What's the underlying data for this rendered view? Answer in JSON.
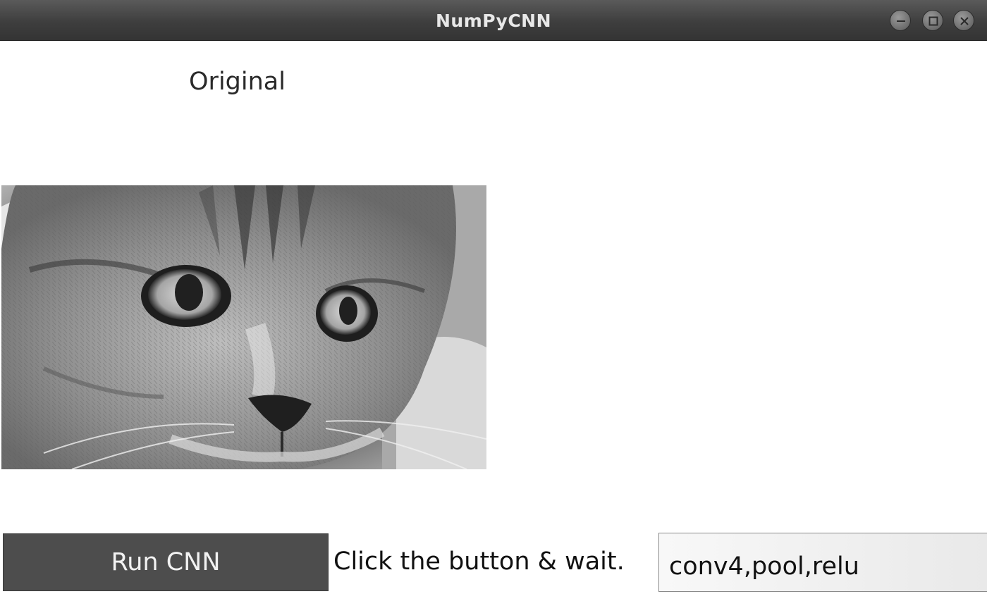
{
  "window": {
    "title": "NumPyCNN",
    "controls": [
      "minimize-icon",
      "maximize-icon",
      "close-icon"
    ]
  },
  "image_panel": {
    "label": "Original",
    "image_subject": "grayscale close-up of a tabby cat's face"
  },
  "controls": {
    "run_button_label": "Run CNN",
    "status_text": "Click the button & wait.",
    "layers_input_value": "conv4,pool,relu"
  },
  "colors": {
    "titlebar": "#3e3e3e",
    "button_bg": "#4d4d4d",
    "button_text": "#f2f2f2"
  }
}
